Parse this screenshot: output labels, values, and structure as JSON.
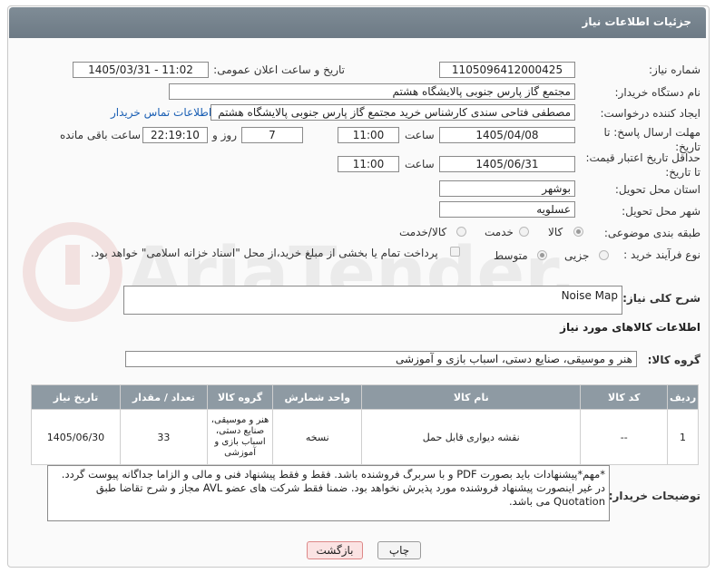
{
  "header": {
    "title": "جزئیات اطلاعات نیاز"
  },
  "form": {
    "need_number_label": "شماره نیاز:",
    "need_number": "1105096412000425",
    "announce_label": "تاریخ و ساعت اعلان عمومی:",
    "announce_value": "1405/03/31 - 11:02",
    "buyer_org_label": "نام دستگاه خریدار:",
    "buyer_org": "مجتمع گاز پارس جنوبی  پالایشگاه هشتم",
    "creator_label": "ایجاد کننده درخواست:",
    "creator": "مصطفی فتاحی سندی کارشناس خرید مجتمع گاز پارس جنوبی  پالایشگاه هشتم",
    "contact_link": "اطلاعات تماس خریدار",
    "reply_deadline_label": "مهلت ارسال پاسخ: تا تاریخ:",
    "reply_date": "1405/04/08",
    "time_label": "ساعت",
    "reply_time": "11:00",
    "days": "7",
    "days_label": "روز و",
    "remaining_time": "22:19:10",
    "remaining_label": "ساعت باقی مانده",
    "price_deadline_label": "حداقل تاریخ اعتبار قیمت: تا تاریخ:",
    "price_date": "1405/06/31",
    "price_time": "11:00",
    "province_label": "استان محل تحویل:",
    "province": "بوشهر",
    "city_label": "شهر محل تحویل:",
    "city": "عسلویه",
    "category_label": "طبقه بندی موضوعی:",
    "category_options": [
      "کالا",
      "خدمت",
      "کالا/خدمت"
    ],
    "process_label": "نوع فرآیند خرید :",
    "process_options": [
      "جزیی",
      "متوسط"
    ],
    "payment_note": "پرداخت تمام یا بخشی از مبلغ خرید،از محل \"اسناد خزانه اسلامی\" خواهد بود."
  },
  "summary": {
    "label": "شرح کلی نیاز:",
    "value": "Noise Map"
  },
  "goods": {
    "section_title": "اطلاعات کالاهای مورد نیاز",
    "group_label": "گروه کالا:",
    "group_value": "هنر و موسیقی، صنایع دستی، اسباب بازی و آموزشی",
    "table": {
      "headers": [
        "ردیف",
        "کد کالا",
        "نام کالا",
        "واحد شمارش",
        "گروه کالا",
        "تعداد / مقدار",
        "تاریخ نیاز"
      ],
      "rows": [
        [
          "1",
          "--",
          "نقشه دیواری قابل حمل",
          "نسخه",
          "هنر و موسیقی، صنایع دستی، اسباب بازی و آموزشی",
          "33",
          "1405/06/30"
        ]
      ]
    }
  },
  "notes": {
    "label": "توضیحات خریدار:",
    "text": "*مهم*پیشنهادات باید بصورت PDF و با سربرگ فروشنده باشد. فقط و فقط پیشنهاد فنی و مالی و الزاما جداگانه پیوست گردد. در غیر اینصورت پیشنهاد فروشنده مورد پذیرش نخواهد بود. ضمنا فقط شرکت های عضو AVL مجاز و شرح تقاضا طبق Quotation می باشد."
  },
  "buttons": {
    "print": "چاپ",
    "back": "بازگشت"
  },
  "watermark": {
    "text": "AriaTender.neT"
  }
}
